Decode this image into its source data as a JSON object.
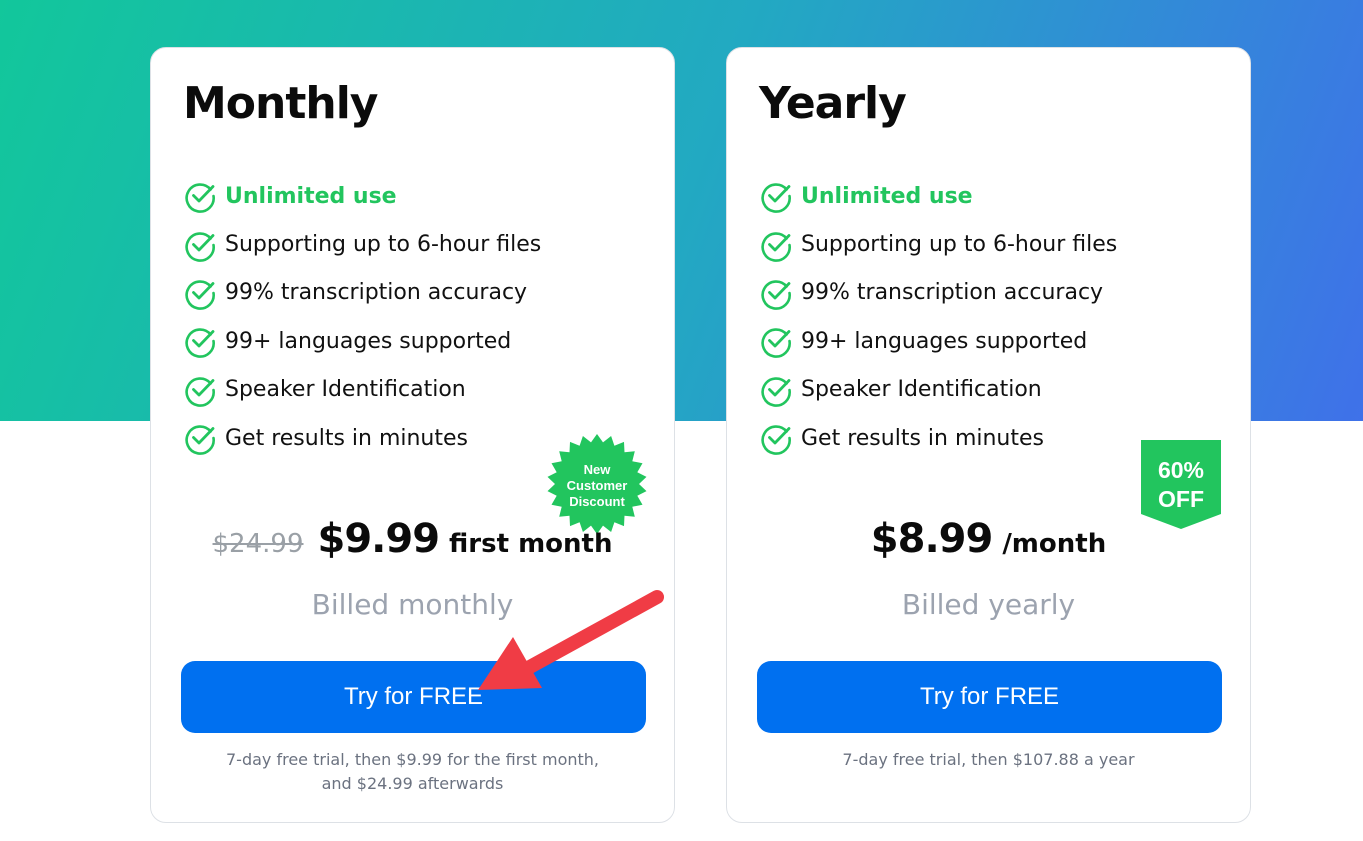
{
  "colors": {
    "gradient_start": "#12c79b",
    "gradient_end": "#3f71e9",
    "check_green": "#22c55e",
    "cta_blue": "#0070f0",
    "muted_gray": "#9ca3af",
    "arrow_red": "#f03c45"
  },
  "plans": [
    {
      "title": "Monthly",
      "features": [
        "Unlimited use",
        "Supporting up to 6-hour files",
        "99% transcription accuracy",
        "99+ languages supported",
        "Speaker Identification",
        "Get results in minutes"
      ],
      "old_price": "$24.99",
      "price": "$9.99",
      "price_suffix": "first month",
      "billing": "Billed monthly",
      "cta": "Try for FREE",
      "fine_print": [
        "7-day free trial, then $9.99 for the first month,",
        "and $24.99 afterwards"
      ],
      "badge": [
        "New",
        "Customer",
        "Discount"
      ]
    },
    {
      "title": "Yearly",
      "features": [
        "Unlimited use",
        "Supporting up to 6-hour files",
        "99% transcription accuracy",
        "99+ languages supported",
        "Speaker Identification",
        "Get results in minutes"
      ],
      "price": "$8.99",
      "price_suffix": "/month",
      "billing": "Billed yearly",
      "cta": "Try for FREE",
      "fine_print": [
        "7-day free trial, then $107.88 a year"
      ],
      "badge": [
        "60%",
        "OFF"
      ]
    }
  ]
}
